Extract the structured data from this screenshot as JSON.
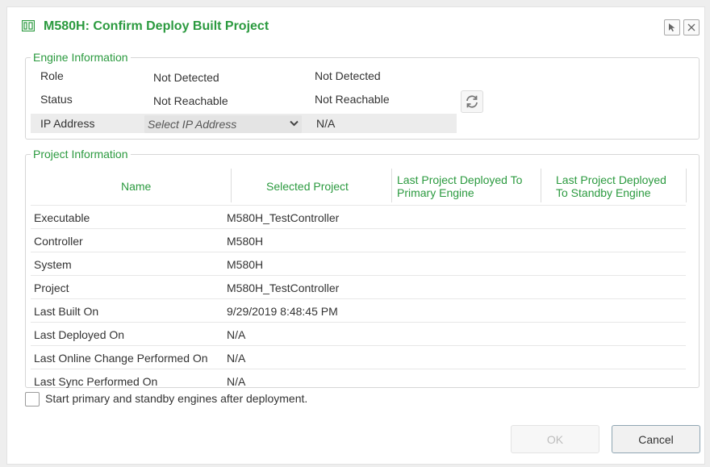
{
  "dialog": {
    "title": "M580H: Confirm Deploy Built Project"
  },
  "engine": {
    "legend": "Engine Information",
    "rows": [
      {
        "label": "Role",
        "primary": "Not Detected",
        "standby": "Not Detected"
      },
      {
        "label": "Status",
        "primary": "Not Reachable",
        "standby": "Not Reachable"
      }
    ],
    "ip": {
      "label": "IP Address",
      "placeholder": "Select IP Address",
      "value": "N/A"
    }
  },
  "project": {
    "legend": "Project Information",
    "headers": [
      "Name",
      "Selected Project",
      "Last Project Deployed To Primary Engine",
      "Last Project Deployed To Standby Engine"
    ],
    "header_lines": {
      "h3a": "Last Project Deployed To",
      "h3b": "Primary Engine",
      "h4a": "Last Project Deployed",
      "h4b": "To Standby Engine"
    },
    "rows": [
      {
        "name": "Executable",
        "selected": "M580H_TestController"
      },
      {
        "name": "Controller",
        "selected": "M580H"
      },
      {
        "name": "System",
        "selected": "M580H"
      },
      {
        "name": "Project",
        "selected": "M580H_TestController"
      },
      {
        "name": "Last Built On",
        "selected": "9/29/2019 8:48:45 PM"
      },
      {
        "name": "Last Deployed On",
        "selected": "N/A"
      },
      {
        "name": "Last Online Change Performed On",
        "selected": "N/A"
      },
      {
        "name": "Last Sync Performed On",
        "selected": "N/A"
      }
    ]
  },
  "options": {
    "start_engines_label": "Start primary and standby engines after deployment.",
    "start_engines_checked": false
  },
  "buttons": {
    "ok": "OK",
    "cancel": "Cancel"
  },
  "colors": {
    "accent": "#2b9a3f"
  }
}
